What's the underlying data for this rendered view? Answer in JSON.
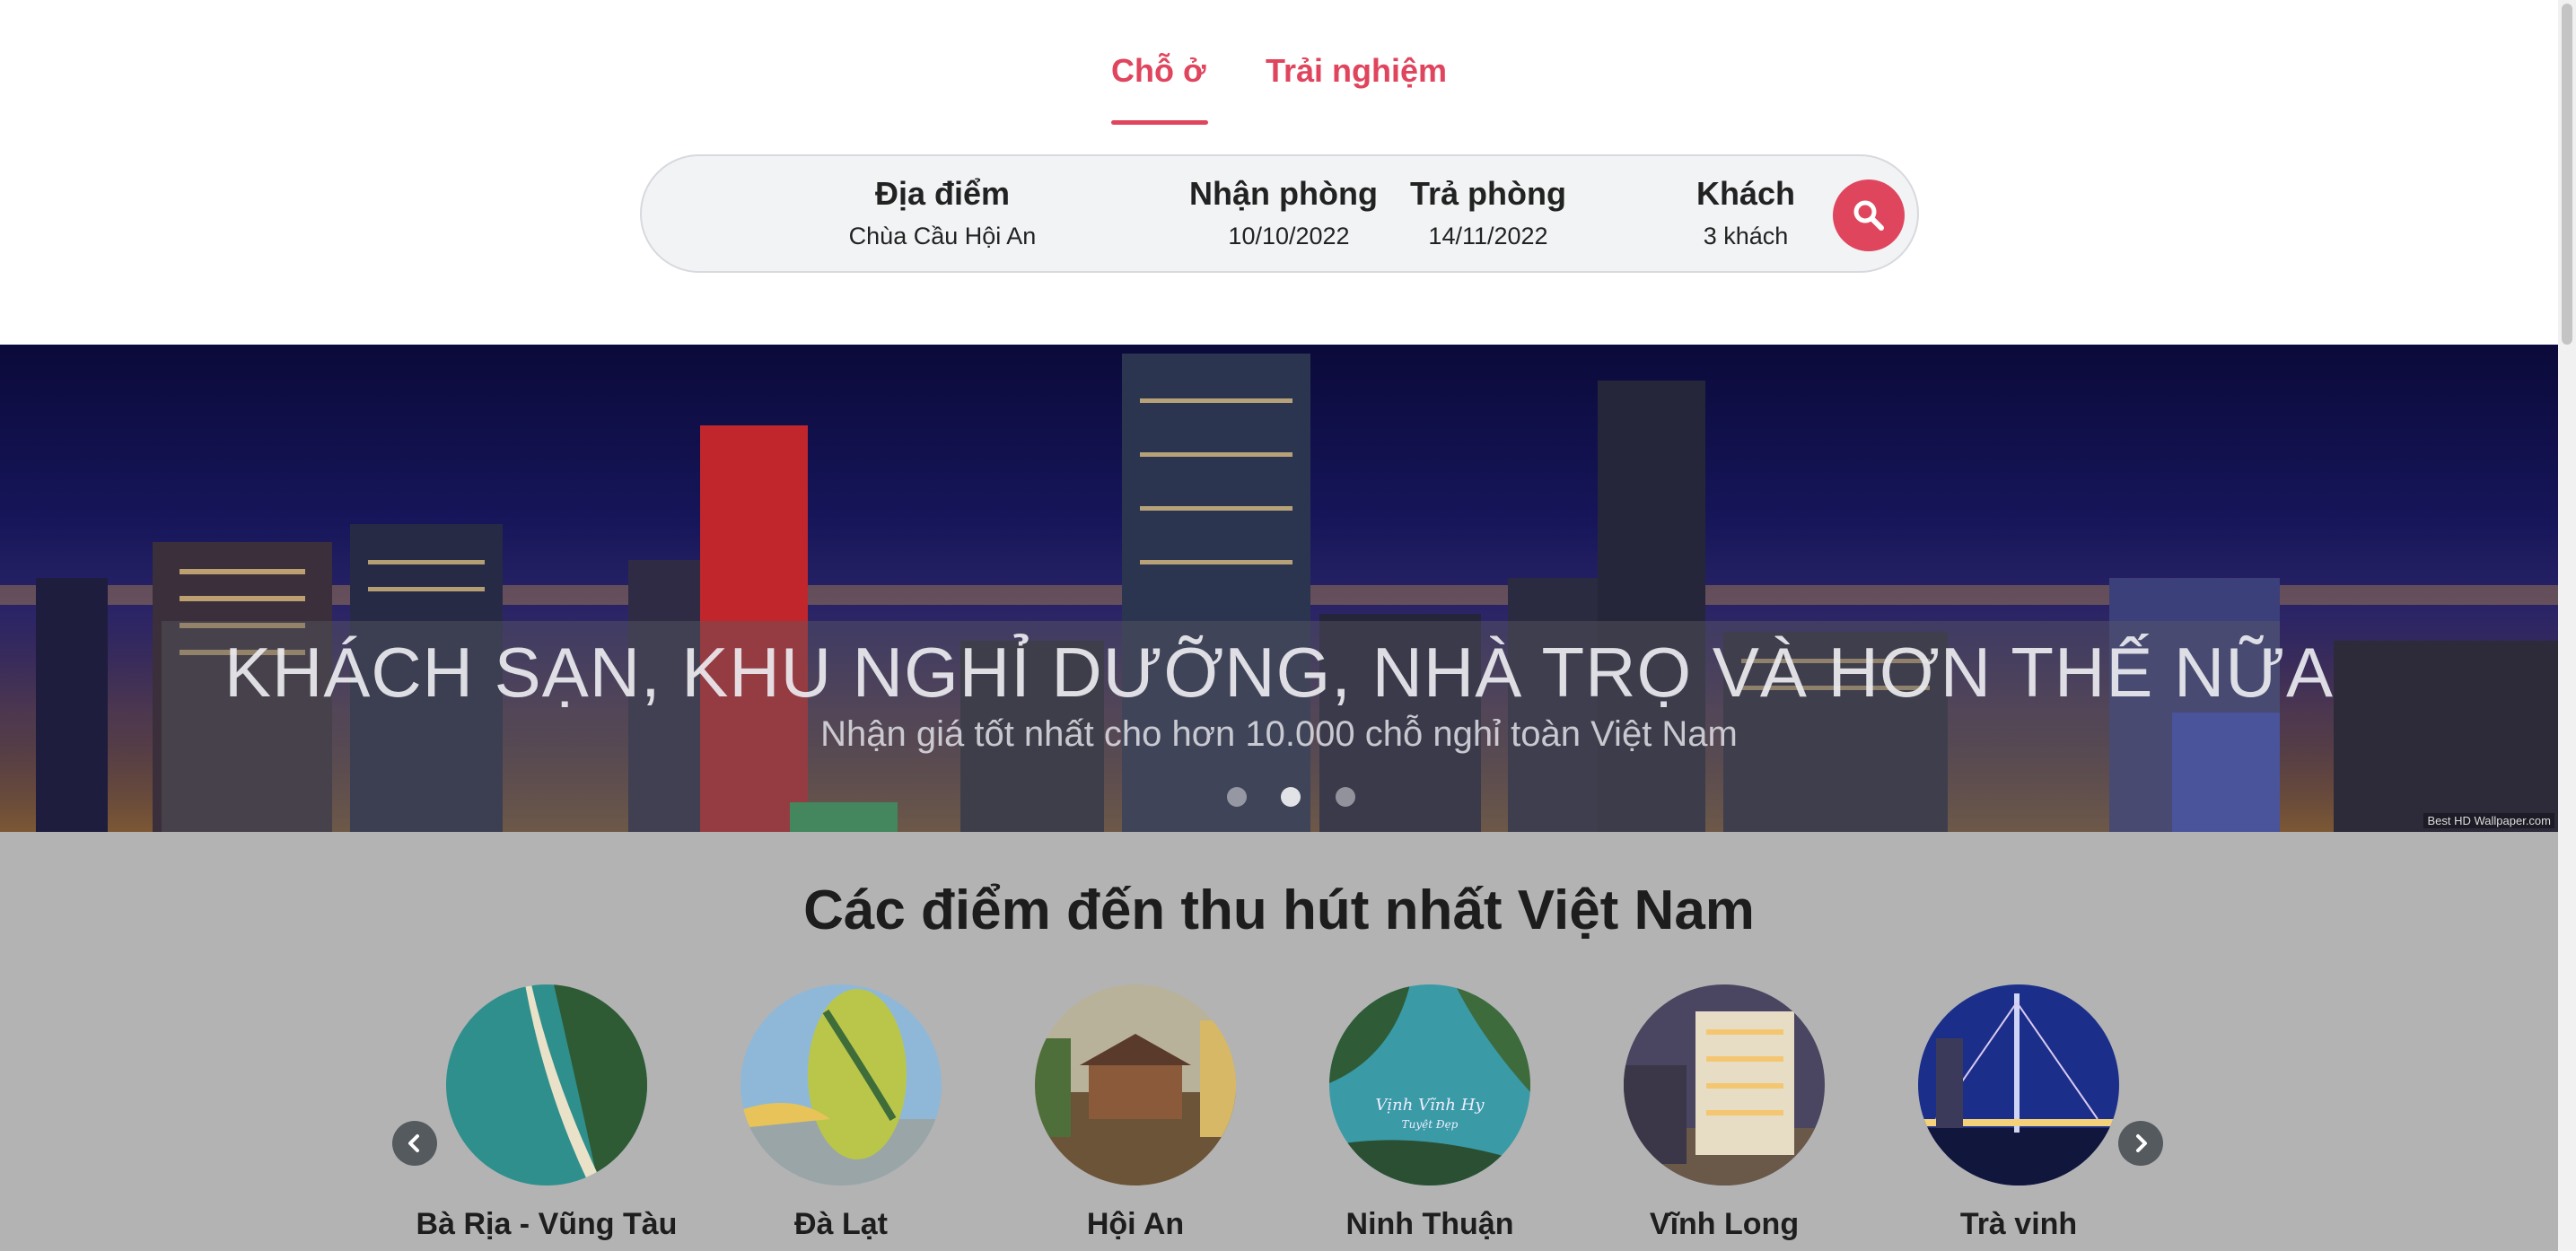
{
  "tabs": [
    {
      "label": "Chỗ ở",
      "active": true
    },
    {
      "label": "Trải nghiệm",
      "active": false
    }
  ],
  "search": {
    "location": {
      "label": "Địa điểm",
      "value": "Chùa Cầu Hội An"
    },
    "checkin": {
      "label": "Nhận phòng",
      "value": "10/10/2022"
    },
    "checkout": {
      "label": "Trả phòng",
      "value": "14/11/2022"
    },
    "guests": {
      "label": "Khách",
      "value": "3 khách"
    },
    "button_icon": "search-icon"
  },
  "hero": {
    "title": "KHÁCH SẠN, KHU NGHỈ DƯỠNG, NHÀ TRỌ VÀ HƠN THẾ NỮA",
    "subtitle": "Nhận giá tốt nhất cho hơn 10.000 chỗ nghỉ toàn Việt Nam",
    "slides": 3,
    "active_slide": 2,
    "watermark": "Best HD Wallpaper.com"
  },
  "destinations": {
    "title": "Các điểm đến thu hút nhất Việt Nam",
    "items": [
      {
        "name": "Bà Rịa - Vũng Tàu"
      },
      {
        "name": "Đà Lạt"
      },
      {
        "name": "Hội An"
      },
      {
        "name": "Ninh Thuận",
        "image_caption": "Vịnh Vĩnh Hy",
        "image_caption_sub": "Tuyệt Đẹp"
      },
      {
        "name": "Vĩnh Long"
      },
      {
        "name": "Trà vinh"
      }
    ],
    "prev_icon": "chevron-left-icon",
    "next_icon": "chevron-right-icon"
  },
  "colors": {
    "accent": "#e0455e",
    "section_bg": "#b3b3b3",
    "search_bg": "#f2f3f5"
  }
}
